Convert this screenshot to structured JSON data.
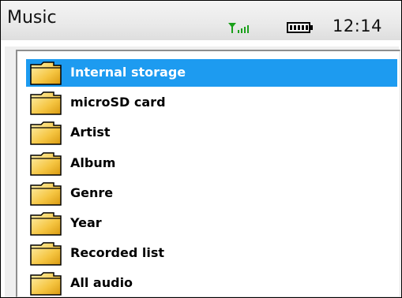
{
  "status_bar": {
    "title": "Music",
    "time": "12:14",
    "signal_icon": "signal-strength-icon",
    "battery_icon": "battery-full-icon",
    "signal_color": "#1aa01a"
  },
  "menu": {
    "selected_index": 0,
    "selection_color": "#1d9bf0",
    "items": [
      {
        "label": "Internal storage",
        "icon": "folder-icon"
      },
      {
        "label": "microSD card",
        "icon": "folder-icon"
      },
      {
        "label": "Artist",
        "icon": "folder-icon"
      },
      {
        "label": "Album",
        "icon": "folder-icon"
      },
      {
        "label": "Genre",
        "icon": "folder-icon"
      },
      {
        "label": "Year",
        "icon": "folder-icon"
      },
      {
        "label": "Recorded list",
        "icon": "folder-icon"
      },
      {
        "label": "All audio",
        "icon": "folder-icon"
      }
    ]
  }
}
